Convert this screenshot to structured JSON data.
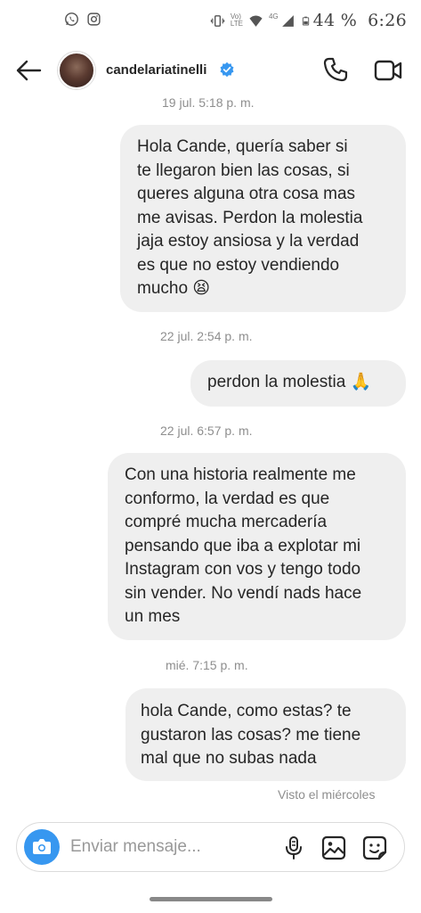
{
  "status_bar": {
    "battery_text": "44 %",
    "time": "6:26",
    "network_label": "4G",
    "volte_label": "Vo)\nLTE",
    "icons": [
      "whatsapp-icon",
      "instagram-icon",
      "vibrate-icon",
      "volte-icon",
      "wifi-icon",
      "signal-icon",
      "battery-icon"
    ]
  },
  "header": {
    "username": "candelariatinelli",
    "verified": true,
    "accent": "#3797f0"
  },
  "chat": {
    "top_timestamp": "19 jul. 5:18 p. m.",
    "items": [
      {
        "type": "message",
        "text": "Hola Cande, quería saber si\nte llegaron bien las cosas, si\nqueres alguna otra cosa mas\nme avisas. Perdon la molestia\njaja estoy ansiosa y la verdad\nes que no estoy vendiendo\nmucho 😫"
      },
      {
        "type": "timestamp",
        "text": "22 jul. 2:54 p. m."
      },
      {
        "type": "message",
        "text": "perdon la molestia 🙏"
      },
      {
        "type": "timestamp",
        "text": "22 jul. 6:57 p. m."
      },
      {
        "type": "message",
        "text": "Con una historia realmente me\nconformo, la verdad es que\ncompré mucha mercadería\npensando que iba a explotar mi\nInstagram con vos y tengo todo\nsin vender. No vendí nads hace\nun mes"
      },
      {
        "type": "timestamp",
        "text": "mié. 7:15 p. m."
      },
      {
        "type": "message",
        "text": "hola Cande, como estas? te\ngustaron las cosas? me tiene\nmal que no subas nada"
      }
    ],
    "seen_status": "Visto el miércoles"
  },
  "composer": {
    "placeholder": "Enviar mensaje..."
  }
}
